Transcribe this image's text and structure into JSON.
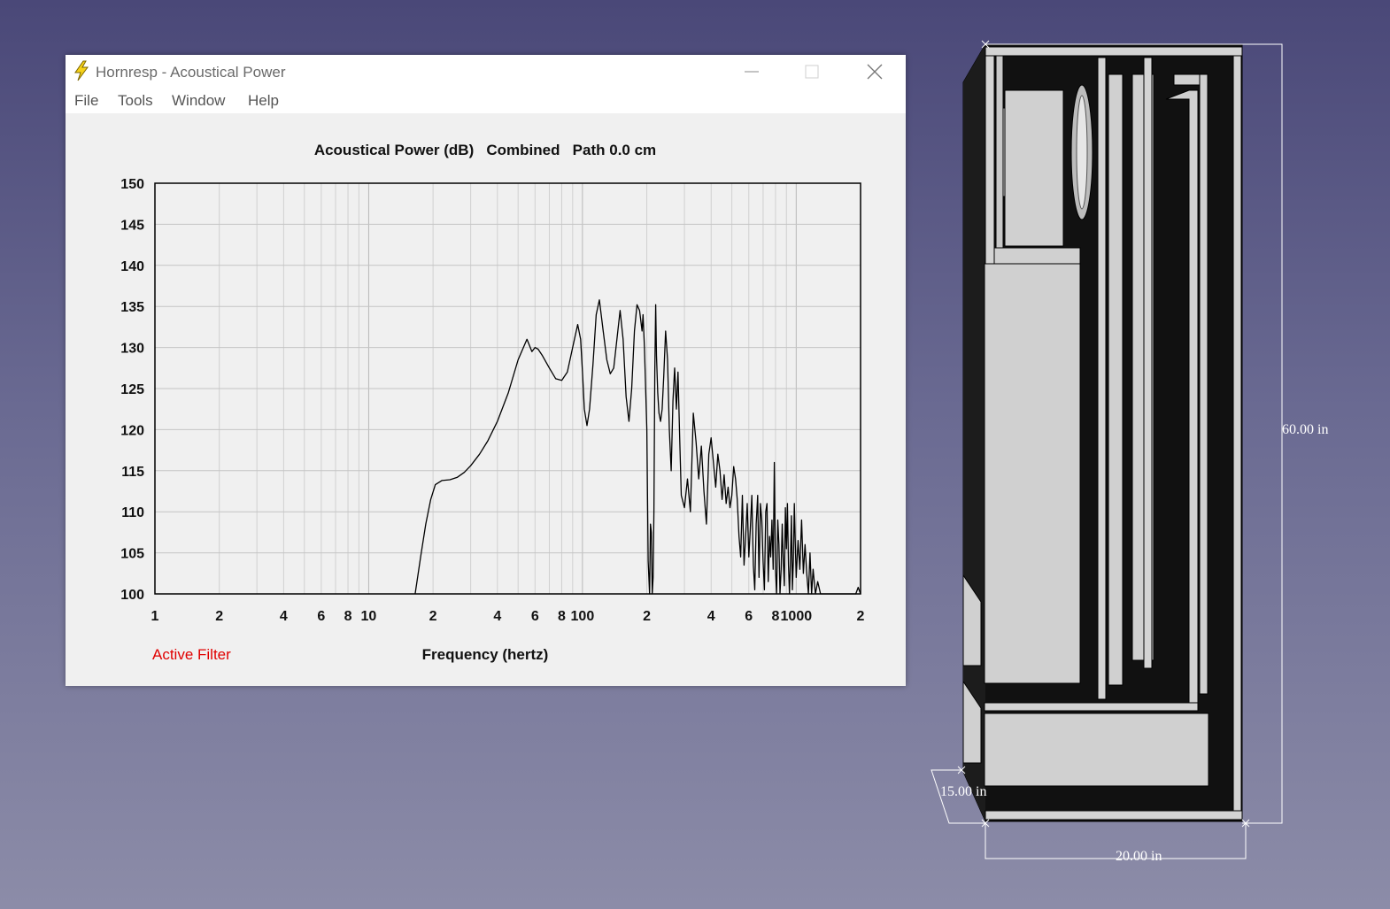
{
  "window": {
    "title": "Hornresp - Acoustical Power",
    "menu": [
      "File",
      "Tools",
      "Window",
      "Help"
    ]
  },
  "chart_data": {
    "type": "line",
    "title": "Acoustical Power (dB)   Combined   Path 0.0 cm",
    "xlabel": "Frequency (hertz)",
    "ylabel": "",
    "x_scale": "log",
    "xlim": [
      1,
      2000
    ],
    "ylim": [
      100,
      150
    ],
    "yticks": [
      100,
      105,
      110,
      115,
      120,
      125,
      130,
      135,
      140,
      145,
      150
    ],
    "xtick_labels": [
      {
        "x": 1,
        "label": "1"
      },
      {
        "x": 2,
        "label": "2"
      },
      {
        "x": 4,
        "label": "4"
      },
      {
        "x": 6,
        "label": "6"
      },
      {
        "x": 8,
        "label": "8"
      },
      {
        "x": 10,
        "label": "10"
      },
      {
        "x": 20,
        "label": "2"
      },
      {
        "x": 40,
        "label": "4"
      },
      {
        "x": 60,
        "label": "6"
      },
      {
        "x": 80,
        "label": "8"
      },
      {
        "x": 100,
        "label": "100"
      },
      {
        "x": 200,
        "label": "2"
      },
      {
        "x": 400,
        "label": "4"
      },
      {
        "x": 600,
        "label": "6"
      },
      {
        "x": 800,
        "label": "8"
      },
      {
        "x": 1000,
        "label": "1000"
      },
      {
        "x": 2000,
        "label": "2"
      }
    ],
    "grid": true,
    "annotation": "Active Filter",
    "series": [
      {
        "color": "#000000",
        "x": [
          16.5,
          17.5,
          18.5,
          19.5,
          20.5,
          22,
          24,
          26,
          28,
          30,
          33,
          36,
          40,
          45,
          50,
          55,
          58,
          60,
          62,
          65,
          70,
          75,
          80,
          85,
          90,
          95,
          98,
          100,
          102,
          105,
          108,
          112,
          116,
          120,
          125,
          130,
          135,
          140,
          145,
          150,
          155,
          160,
          165,
          170,
          175,
          180,
          185,
          190,
          192,
          195,
          200,
          203,
          206,
          208,
          210,
          212,
          214,
          216,
          218,
          220,
          222,
          225,
          228,
          232,
          236,
          240,
          245,
          250,
          255,
          260,
          265,
          270,
          275,
          280,
          285,
          290,
          300,
          310,
          320,
          330,
          340,
          350,
          360,
          370,
          380,
          390,
          400,
          410,
          420,
          430,
          440,
          450,
          460,
          470,
          480,
          490,
          500,
          510,
          520,
          530,
          540,
          550,
          560,
          570,
          580,
          590,
          600,
          610,
          620,
          630,
          640,
          650,
          660,
          670,
          680,
          690,
          700,
          710,
          720,
          730,
          740,
          750,
          760,
          770,
          780,
          790,
          800,
          810,
          820,
          830,
          840,
          850,
          860,
          870,
          880,
          890,
          900,
          910,
          920,
          930,
          940,
          950,
          960,
          970,
          980,
          990,
          1000,
          1020,
          1040,
          1060,
          1080,
          1100,
          1120,
          1140,
          1160,
          1180,
          1200,
          1230,
          1260,
          1300,
          1900,
          1950,
          2000
        ],
        "y": [
          100,
          104.5,
          108.5,
          111.5,
          113.3,
          113.8,
          113.9,
          114.2,
          114.8,
          115.6,
          117,
          118.6,
          121,
          124.5,
          128.5,
          131,
          129.5,
          130,
          129.8,
          129,
          127.5,
          126.2,
          126,
          127,
          130,
          132.8,
          131,
          127,
          122.5,
          120.5,
          122.5,
          128,
          134,
          135.8,
          132,
          128.5,
          126.8,
          127.5,
          131,
          134.5,
          131,
          124,
          121,
          125,
          132,
          135.2,
          134.5,
          132,
          134,
          130,
          120,
          104,
          100,
          108.5,
          107.5,
          100,
          102,
          110,
          127,
          135.2,
          129,
          124.5,
          122,
          121,
          122.5,
          126.5,
          132,
          128.5,
          120,
          115,
          123.5,
          127.5,
          122.5,
          127,
          119,
          112,
          110.5,
          114,
          110,
          122,
          118.5,
          114,
          118,
          112.5,
          108.5,
          117,
          119,
          116,
          113,
          117,
          115,
          111.5,
          114.5,
          111,
          113,
          110.5,
          112,
          115.5,
          114,
          111.5,
          107,
          104.5,
          112,
          103.5,
          107,
          111,
          104.5,
          108,
          112,
          103.5,
          100.5,
          108.5,
          112,
          102,
          111,
          109,
          104,
          100.5,
          110,
          111,
          101.5,
          107,
          104.5,
          109,
          103,
          116,
          103,
          100,
          109,
          106,
          100,
          103,
          108.5,
          104,
          101,
          110.5,
          105.5,
          111,
          103.5,
          100,
          104,
          109.5,
          100.5,
          104,
          111,
          106,
          102,
          106.5,
          103,
          109,
          102.5,
          106,
          102.5,
          100,
          105,
          100,
          103,
          100,
          101.5,
          100,
          100,
          100.8,
          100
        ]
      }
    ]
  },
  "cad": {
    "height_label": "60.00 in",
    "depth_label": "15.00 in",
    "width_label": "20.00 in"
  }
}
